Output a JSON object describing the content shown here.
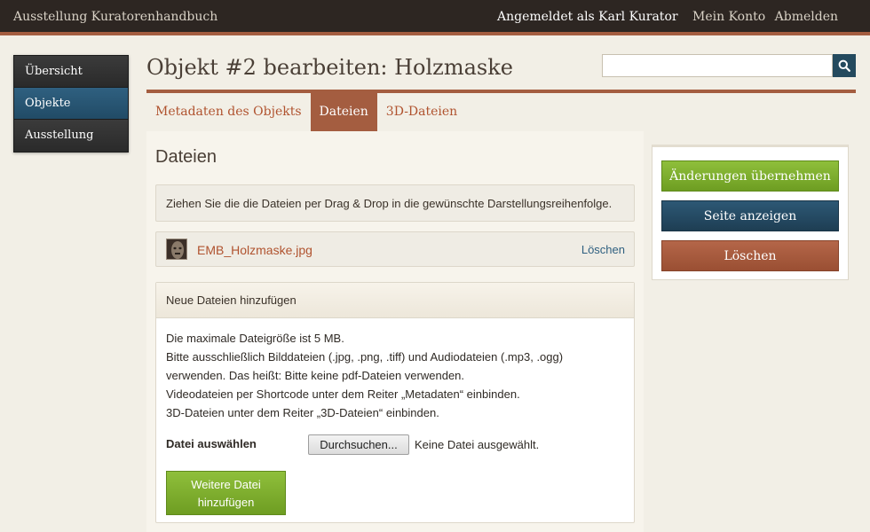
{
  "header": {
    "app_title": "Ausstellung Kuratorenhandbuch",
    "logged_in_as": "Angemeldet als Karl Kurator",
    "my_account": "Mein Konto",
    "logout": "Abmelden"
  },
  "sidebar": {
    "items": [
      {
        "label": "Übersicht",
        "active": false
      },
      {
        "label": "Objekte",
        "active": true
      },
      {
        "label": "Ausstellung",
        "active": false
      }
    ]
  },
  "page": {
    "title": "Objekt #2 bearbeiten: Holzmaske"
  },
  "search": {
    "value": "",
    "placeholder": ""
  },
  "tabs": [
    {
      "label": "Metadaten des Objekts",
      "active": false
    },
    {
      "label": "Dateien",
      "active": true
    },
    {
      "label": "3D-Dateien",
      "active": false
    }
  ],
  "files": {
    "heading": "Dateien",
    "hint": "Ziehen Sie die die Dateien per Drag & Drop in die gewünschte Darstellungsreihenfolge.",
    "list": [
      {
        "name": "EMB_Holzmaske.jpg",
        "delete_label": "Löschen"
      }
    ]
  },
  "upload": {
    "heading": "Neue Dateien hinzufügen",
    "info_lines": [
      "Die maximale Dateigröße ist 5 MB.",
      "Bitte ausschließlich Bilddateien (.jpg, .png, .tiff) und Audiodateien (.mp3, .ogg)",
      "verwenden. Das heißt: Bitte keine pdf-Dateien verwenden.",
      "Videodateien per Shortcode unter dem Reiter „Metadaten“ einbinden.",
      "3D-Dateien unter dem Reiter „3D-Dateien“ einbinden."
    ],
    "choose_label": "Datei auswählen",
    "browse_label": "Durchsuchen...",
    "no_file": "Keine Datei ausgewählt.",
    "more_line1": "Weitere Datei",
    "more_line2": "hinzufügen"
  },
  "actions": {
    "apply": "Änderungen übernehmen",
    "view": "Seite anzeigen",
    "delete": "Löschen"
  },
  "colors": {
    "accent": "#a45d40",
    "nav_active": "#2f6080",
    "green": "#7fb030",
    "navy": "#244a5e"
  }
}
